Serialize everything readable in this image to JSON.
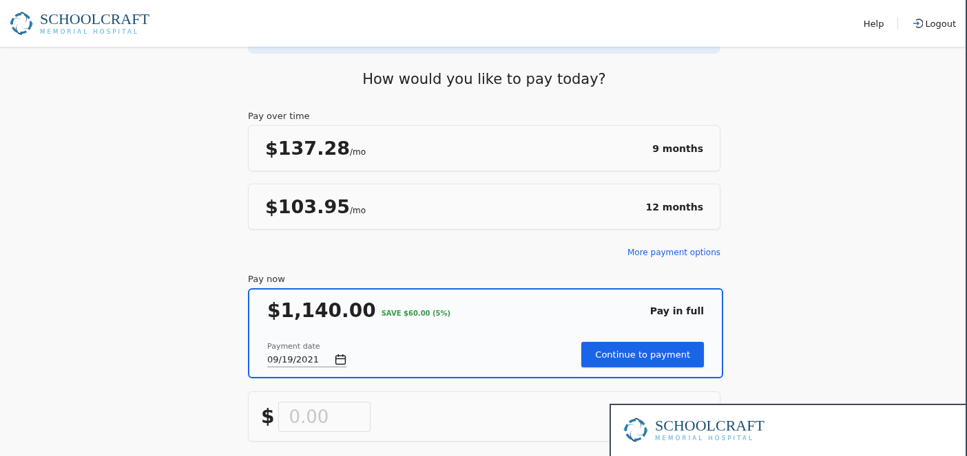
{
  "header": {
    "logo": {
      "name": "SCHOOLCRAFT",
      "subtitle": "MEMORIAL HOSPITAL"
    },
    "links": [
      {
        "label": "Help",
        "kind": "text"
      },
      {
        "label": "Logout",
        "kind": "logout"
      }
    ]
  },
  "title": "How would you like to pay today?",
  "pay_over_time": {
    "label": "Pay over time",
    "options": [
      {
        "amount": "$137.28",
        "unit": "/mo",
        "term": "9 months",
        "selected": false
      },
      {
        "amount": "$103.95",
        "unit": "/mo",
        "term": "12 months",
        "selected": false
      }
    ],
    "more_link": "More payment options"
  },
  "pay_now": {
    "label": "Pay now",
    "full": {
      "amount": "$1,140.00",
      "savings": "SAVE $60.00 (5%)",
      "term": "Pay in full",
      "date_label": "Payment date",
      "date": "09/19/2021",
      "button": "Continue to payment",
      "selected": true
    },
    "custom": {
      "currency": "$",
      "placeholder": "0.00",
      "selected": false
    }
  },
  "overlay": {
    "logo": {
      "name": "SCHOOLCRAFT",
      "subtitle": "MEMORIAL HOSPITAL"
    }
  }
}
